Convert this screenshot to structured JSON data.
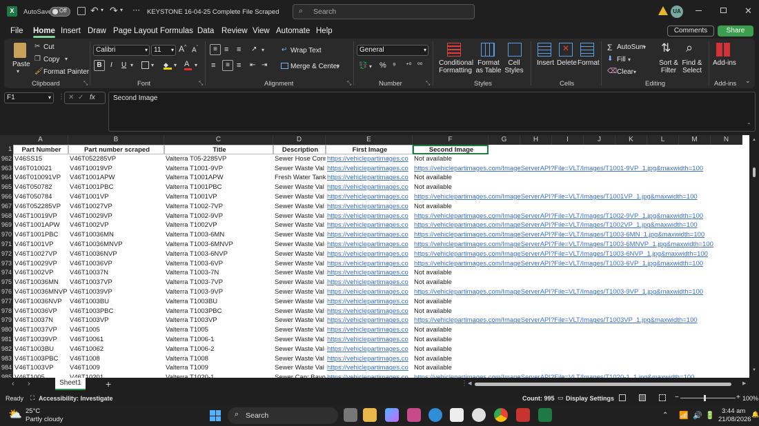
{
  "titlebar": {
    "autosave_label": "AutoSave",
    "toggle_state": "Off",
    "file_name": "KEYSTONE 16-04-25 Complete File Scraped",
    "search_placeholder": "Search",
    "user_initials": "UA"
  },
  "menu": {
    "tabs": [
      "File",
      "Home",
      "Insert",
      "Draw",
      "Page Layout",
      "Formulas",
      "Data",
      "Review",
      "View",
      "Automate",
      "Help"
    ],
    "active": "Home",
    "comments_label": "Comments",
    "share_label": "Share"
  },
  "ribbon": {
    "clipboard": {
      "paste": "Paste",
      "cut": "Cut",
      "copy": "Copy",
      "format_painter": "Format Painter",
      "label": "Clipboard"
    },
    "font": {
      "family": "Calibri",
      "size": "11",
      "label": "Font",
      "bold": "B",
      "italic": "I",
      "underline": "U"
    },
    "alignment": {
      "wrap": "Wrap Text",
      "merge": "Merge & Center",
      "label": "Alignment"
    },
    "number": {
      "format": "General",
      "label": "Number"
    },
    "styles": {
      "conditional": "Conditional Formatting",
      "format_table": "Format as Table",
      "cell_styles": "Cell Styles",
      "label": "Styles"
    },
    "cells": {
      "insert": "Insert",
      "delete": "Delete",
      "format": "Format",
      "label": "Cells"
    },
    "editing": {
      "autosum": "AutoSum",
      "fill": "Fill",
      "clear": "Clear",
      "sort": "Sort & Filter",
      "find": "Find & Select",
      "label": "Editing"
    },
    "addins": {
      "addins": "Add-ins",
      "label": "Add-ins"
    }
  },
  "formula_bar": {
    "cell_ref": "F1",
    "fx": "fx",
    "content": "Second Image"
  },
  "columns": [
    "A",
    "B",
    "C",
    "D",
    "E",
    "F",
    "G",
    "H",
    "I",
    "J",
    "K",
    "L",
    "M",
    "N"
  ],
  "header_row": {
    "num": "1",
    "a": "Part Number",
    "b": "Part number scraped",
    "c": "Title",
    "d": "Description",
    "e": "First Image",
    "f": "Second Image"
  },
  "rows": [
    {
      "num": "962",
      "a": "V46SS15",
      "b": "V46T052285VP",
      "c": "Valterra T05-2285VP",
      "d": "Sewer Hose Conn",
      "e": "https://vehiclepartimages.co",
      "f": "Not available"
    },
    {
      "num": "963",
      "a": "V46T010021",
      "b": "V46T10019VP",
      "c": "Valterra T1001-9VP",
      "d": "Sewer Waste Val",
      "e": "https://vehiclepartimages.co",
      "f": "https://vehiclepartimages.com/ImageServerAPI?File=VLT/Images/T1001-9VP_1.jpg&maxwidth=100"
    },
    {
      "num": "964",
      "a": "V46T010091VP",
      "b": "V46T1001APW",
      "c": "Valterra T1001APW",
      "d": "Fresh Water Tank",
      "e": "https://vehiclepartimages.co",
      "f": "Not available"
    },
    {
      "num": "965",
      "a": "V46T050782",
      "b": "V46T1001PBC",
      "c": "Valterra T1001PBC",
      "d": "Sewer Waste Val",
      "e": "https://vehiclepartimages.co",
      "f": "Not available"
    },
    {
      "num": "966",
      "a": "V46T050784",
      "b": "V46T1001VP",
      "c": "Valterra T1001VP",
      "d": "Sewer Waste Val",
      "e": "https://vehiclepartimages.co",
      "f": "https://vehiclepartimages.com/ImageServerAPI?File=VLT/Images/T1001VP_1.jpg&maxwidth=100"
    },
    {
      "num": "967",
      "a": "V46T052285VP",
      "b": "V46T10027VP",
      "c": "Valterra T1002-7VP",
      "d": "Sewer Waste Val",
      "e": "https://vehiclepartimages.co",
      "f": "Not available"
    },
    {
      "num": "968",
      "a": "V46T10019VP",
      "b": "V46T10029VP",
      "c": "Valterra T1002-9VP",
      "d": "Sewer Waste Val",
      "e": "https://vehiclepartimages.co",
      "f": "https://vehiclepartimages.com/ImageServerAPI?File=VLT/Images/T1002-9VP_1.jpg&maxwidth=100"
    },
    {
      "num": "969",
      "a": "V46T1001APW",
      "b": "V46T1002VP",
      "c": "Valterra T1002VP",
      "d": "Sewer Waste Val",
      "e": "https://vehiclepartimages.co",
      "f": "https://vehiclepartimages.com/ImageServerAPI?File=VLT/Images/T1002VP_1.jpg&maxwidth=100"
    },
    {
      "num": "970",
      "a": "V46T1001PBC",
      "b": "V46T10036MN",
      "c": "Valterra T1003-6MN",
      "d": "Sewer Waste Val",
      "e": "https://vehiclepartimages.co",
      "f": "https://vehiclepartimages.com/ImageServerAPI?File=VLT/Images/T1003-6MN_1.jpg&maxwidth=100"
    },
    {
      "num": "971",
      "a": "V46T1001VP",
      "b": "V46T10036MNVP",
      "c": "Valterra T1003-6MNVP",
      "d": "Sewer Waste Val",
      "e": "https://vehiclepartimages.co",
      "f": "https://vehiclepartimages.com/ImageServerAPI?File=VLT/Images/T1003-6MNVP_1.jpg&maxwidth=100"
    },
    {
      "num": "972",
      "a": "V46T10027VP",
      "b": "V46T10036NVP",
      "c": "Valterra T1003-6NVP",
      "d": "Sewer Waste Val",
      "e": "https://vehiclepartimages.co",
      "f": "https://vehiclepartimages.com/ImageServerAPI?File=VLT/Images/T1003-6NVP_1.jpg&maxwidth=100"
    },
    {
      "num": "973",
      "a": "V46T10029VP",
      "b": "V46T10036VP",
      "c": "Valterra T1003-6VP",
      "d": "Sewer Waste Val",
      "e": "https://vehiclepartimages.co",
      "f": "https://vehiclepartimages.com/ImageServerAPI?File=VLT/Images/T1003-6VP_1.jpg&maxwidth=100"
    },
    {
      "num": "974",
      "a": "V46T1002VP",
      "b": "V46T10037N",
      "c": "Valterra T1003-7N",
      "d": "Sewer Waste Val",
      "e": "https://vehiclepartimages.co",
      "f": "Not available"
    },
    {
      "num": "975",
      "a": "V46T10036MN",
      "b": "V46T10037VP",
      "c": "Valterra T1003-7VP",
      "d": "Sewer Waste Val",
      "e": "https://vehiclepartimages.co",
      "f": "Not available"
    },
    {
      "num": "976",
      "a": "V46T10036MNVP",
      "b": "V46T10039VP",
      "c": "Valterra T1003-9VP",
      "d": "Sewer Waste Val",
      "e": "https://vehiclepartimages.co",
      "f": "https://vehiclepartimages.com/ImageServerAPI?File=VLT/Images/T1003-9VP_1.jpg&maxwidth=100"
    },
    {
      "num": "977",
      "a": "V46T10036NVP",
      "b": "V46T1003BU",
      "c": "Valterra T1003BU",
      "d": "Sewer Waste Val",
      "e": "https://vehiclepartimages.co",
      "f": "Not available"
    },
    {
      "num": "978",
      "a": "V46T10036VP",
      "b": "V46T1003PBC",
      "c": "Valterra T1003PBC",
      "d": "Sewer Waste Val",
      "e": "https://vehiclepartimages.co",
      "f": "Not available"
    },
    {
      "num": "979",
      "a": "V46T10037N",
      "b": "V46T1003VP",
      "c": "Valterra T1003VP",
      "d": "Sewer Waste Val",
      "e": "https://vehiclepartimages.co",
      "f": "https://vehiclepartimages.com/ImageServerAPI?File=VLT/Images/T1003VP_1.jpg&maxwidth=100"
    },
    {
      "num": "980",
      "a": "V46T10037VP",
      "b": "V46T1005",
      "c": "Valterra T1005",
      "d": "Sewer Waste Val",
      "e": "https://vehiclepartimages.co",
      "f": "Not available"
    },
    {
      "num": "981",
      "a": "V46T10039VP",
      "b": "V46T10061",
      "c": "Valterra T1006-1",
      "d": "Sewer Waste Val",
      "e": "https://vehiclepartimages.co",
      "f": "Not available"
    },
    {
      "num": "982",
      "a": "V46T1003BU",
      "b": "V46T10062",
      "c": "Valterra T1006-2",
      "d": "Sewer Waste Val",
      "e": "https://vehiclepartimages.co",
      "f": "Not available"
    },
    {
      "num": "983",
      "a": "V46T1003PBC",
      "b": "V46T1008",
      "c": "Valterra T1008",
      "d": "Sewer Waste Val",
      "e": "https://vehiclepartimages.co",
      "f": "Not available"
    },
    {
      "num": "984",
      "a": "V46T1003VP",
      "b": "V46T1009",
      "c": "Valterra T1009",
      "d": "Sewer Waste Val",
      "e": "https://vehiclepartimages.co",
      "f": "Not available"
    },
    {
      "num": "985",
      "a": "V46T1005",
      "b": "V46T10201",
      "c": "Valterra T1020-1",
      "d": "Sewer Cap; Bayor",
      "e": "https://vehiclepartimages.co",
      "f": "https://vehiclepartimages.com/ImageServerAPI?File=VLT/Images/T1020-1_1.jpg&maxwidth=100"
    }
  ],
  "sheet_tabs": [
    "Sheet1"
  ],
  "status": {
    "ready": "Ready",
    "accessibility": "Accessibility: Investigate",
    "count": "Count: 995",
    "display": "Display Settings",
    "zoom": "100%"
  },
  "taskbar": {
    "temp": "25°C",
    "weather": "Partly cloudy",
    "search": "Search",
    "time": "3:44 am",
    "date": "21/08/2026"
  },
  "colors": {
    "accent": "#7fd59b",
    "link": "#3a6fd2",
    "share": "#3a9e4e"
  }
}
